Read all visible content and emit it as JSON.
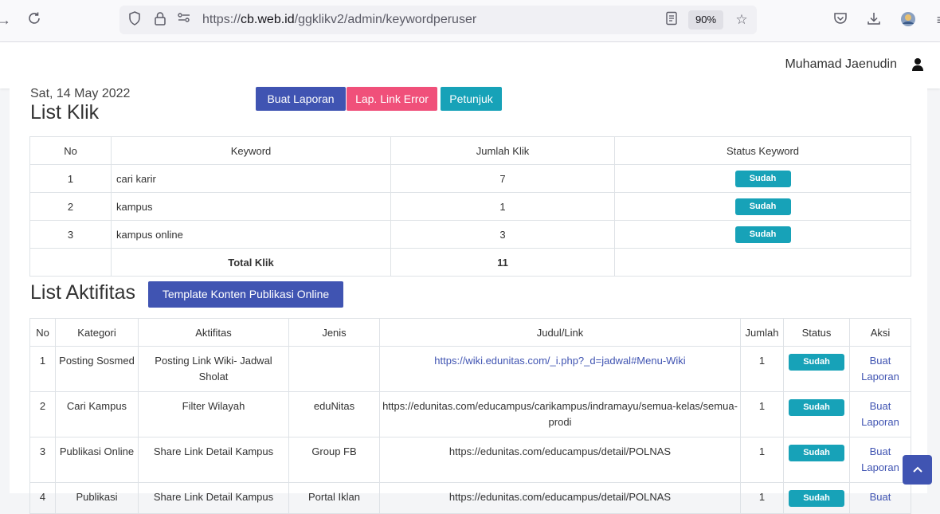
{
  "browser": {
    "url_prefix": "https://",
    "url_domain": "cb.web.id",
    "url_path": "/ggklikv2/admin/keywordperuser",
    "zoom": "90%"
  },
  "header": {
    "user_name": "Muhamad Jaenudin"
  },
  "list_klik": {
    "date": "Sat, 14 May 2022",
    "title": "List Klik",
    "buttons": {
      "buat_laporan": "Buat Laporan",
      "lap_link_error": "Lap. Link Error",
      "petunjuk": "Petunjuk"
    },
    "columns": [
      "No",
      "Keyword",
      "Jumlah Klik",
      "Status Keyword"
    ],
    "rows": [
      {
        "no": "1",
        "keyword": "cari karir",
        "jumlah": "7",
        "status": "Sudah"
      },
      {
        "no": "2",
        "keyword": "kampus",
        "jumlah": "1",
        "status": "Sudah"
      },
      {
        "no": "3",
        "keyword": "kampus online",
        "jumlah": "3",
        "status": "Sudah"
      }
    ],
    "total_label": "Total Klik",
    "total_value": "11"
  },
  "list_aktifitas": {
    "title": "List Aktifitas",
    "template_button": "Template Konten Publikasi Online",
    "columns": [
      "No",
      "Kategori",
      "Aktifitas",
      "Jenis",
      "Judul/Link",
      "Jumlah",
      "Status",
      "Aksi"
    ],
    "rows": [
      {
        "no": "1",
        "kategori": "Posting Sosmed",
        "aktifitas": "Posting Link Wiki- Jadwal Sholat",
        "jenis": "",
        "judul": "https://wiki.edunitas.com/_i.php?_d=jadwal#Menu-Wiki",
        "jumlah": "1",
        "status": "Sudah",
        "aksi": "Buat Laporan"
      },
      {
        "no": "2",
        "kategori": "Cari Kampus",
        "aktifitas": "Filter Wilayah",
        "jenis": "eduNitas",
        "judul": "https://edunitas.com/educampus/carikampus/indramayu/semua-kelas/semua-prodi",
        "jumlah": "1",
        "status": "Sudah",
        "aksi": "Buat Laporan"
      },
      {
        "no": "3",
        "kategori": "Publikasi Online",
        "aktifitas": "Share Link Detail Kampus",
        "jenis": "Group FB",
        "judul": "https://edunitas.com/educampus/detail/POLNAS",
        "jumlah": "1",
        "status": "Sudah",
        "aksi": "Buat Laporan"
      },
      {
        "no": "4",
        "kategori": "Publikasi",
        "aktifitas": "Share Link Detail Kampus",
        "jenis": "Portal Iklan",
        "judul": "https://edunitas.com/educampus/detail/POLNAS",
        "jumlah": "1",
        "status": "Sudah",
        "aksi": "Buat"
      }
    ]
  },
  "colors": {
    "primary": "#4054b2",
    "pink": "#f0507a",
    "info": "#17a2b8"
  }
}
